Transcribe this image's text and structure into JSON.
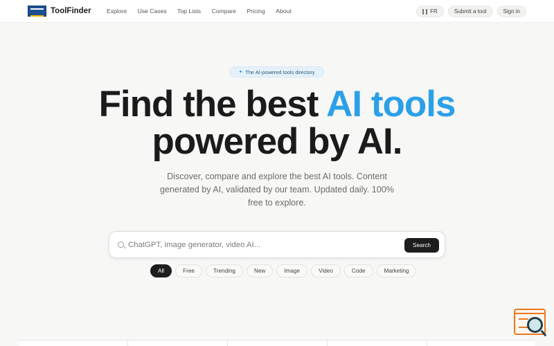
{
  "nav": {
    "brand": "ToolFinder",
    "links": [
      "Explore",
      "Use Cases",
      "Top Lists",
      "Compare",
      "Pricing",
      "About"
    ],
    "lang": "FR",
    "submit": "Submit a tool",
    "signin": "Sign in"
  },
  "hero": {
    "badge": "The AI-powered tools directory",
    "headline_line1_prefix": "Find the best ",
    "headline_line1_accent": "AI tools",
    "headline_line2": "powered by AI.",
    "subline": "Discover, compare and explore the best AI tools. Content generated by AI, validated by our team. Updated daily. 100% free to explore."
  },
  "search": {
    "placeholder": "ChatGPT, image generator, video AI...",
    "value": "",
    "button": "Search"
  },
  "filters": {
    "active": "All",
    "chips": [
      "All",
      "Free",
      "Trending",
      "New",
      "Image",
      "Video",
      "Code",
      "Marketing"
    ]
  },
  "colors": {
    "accent": "#2ba0e8",
    "dark": "#1d1d1d",
    "widget_orange": "#e9781f"
  }
}
